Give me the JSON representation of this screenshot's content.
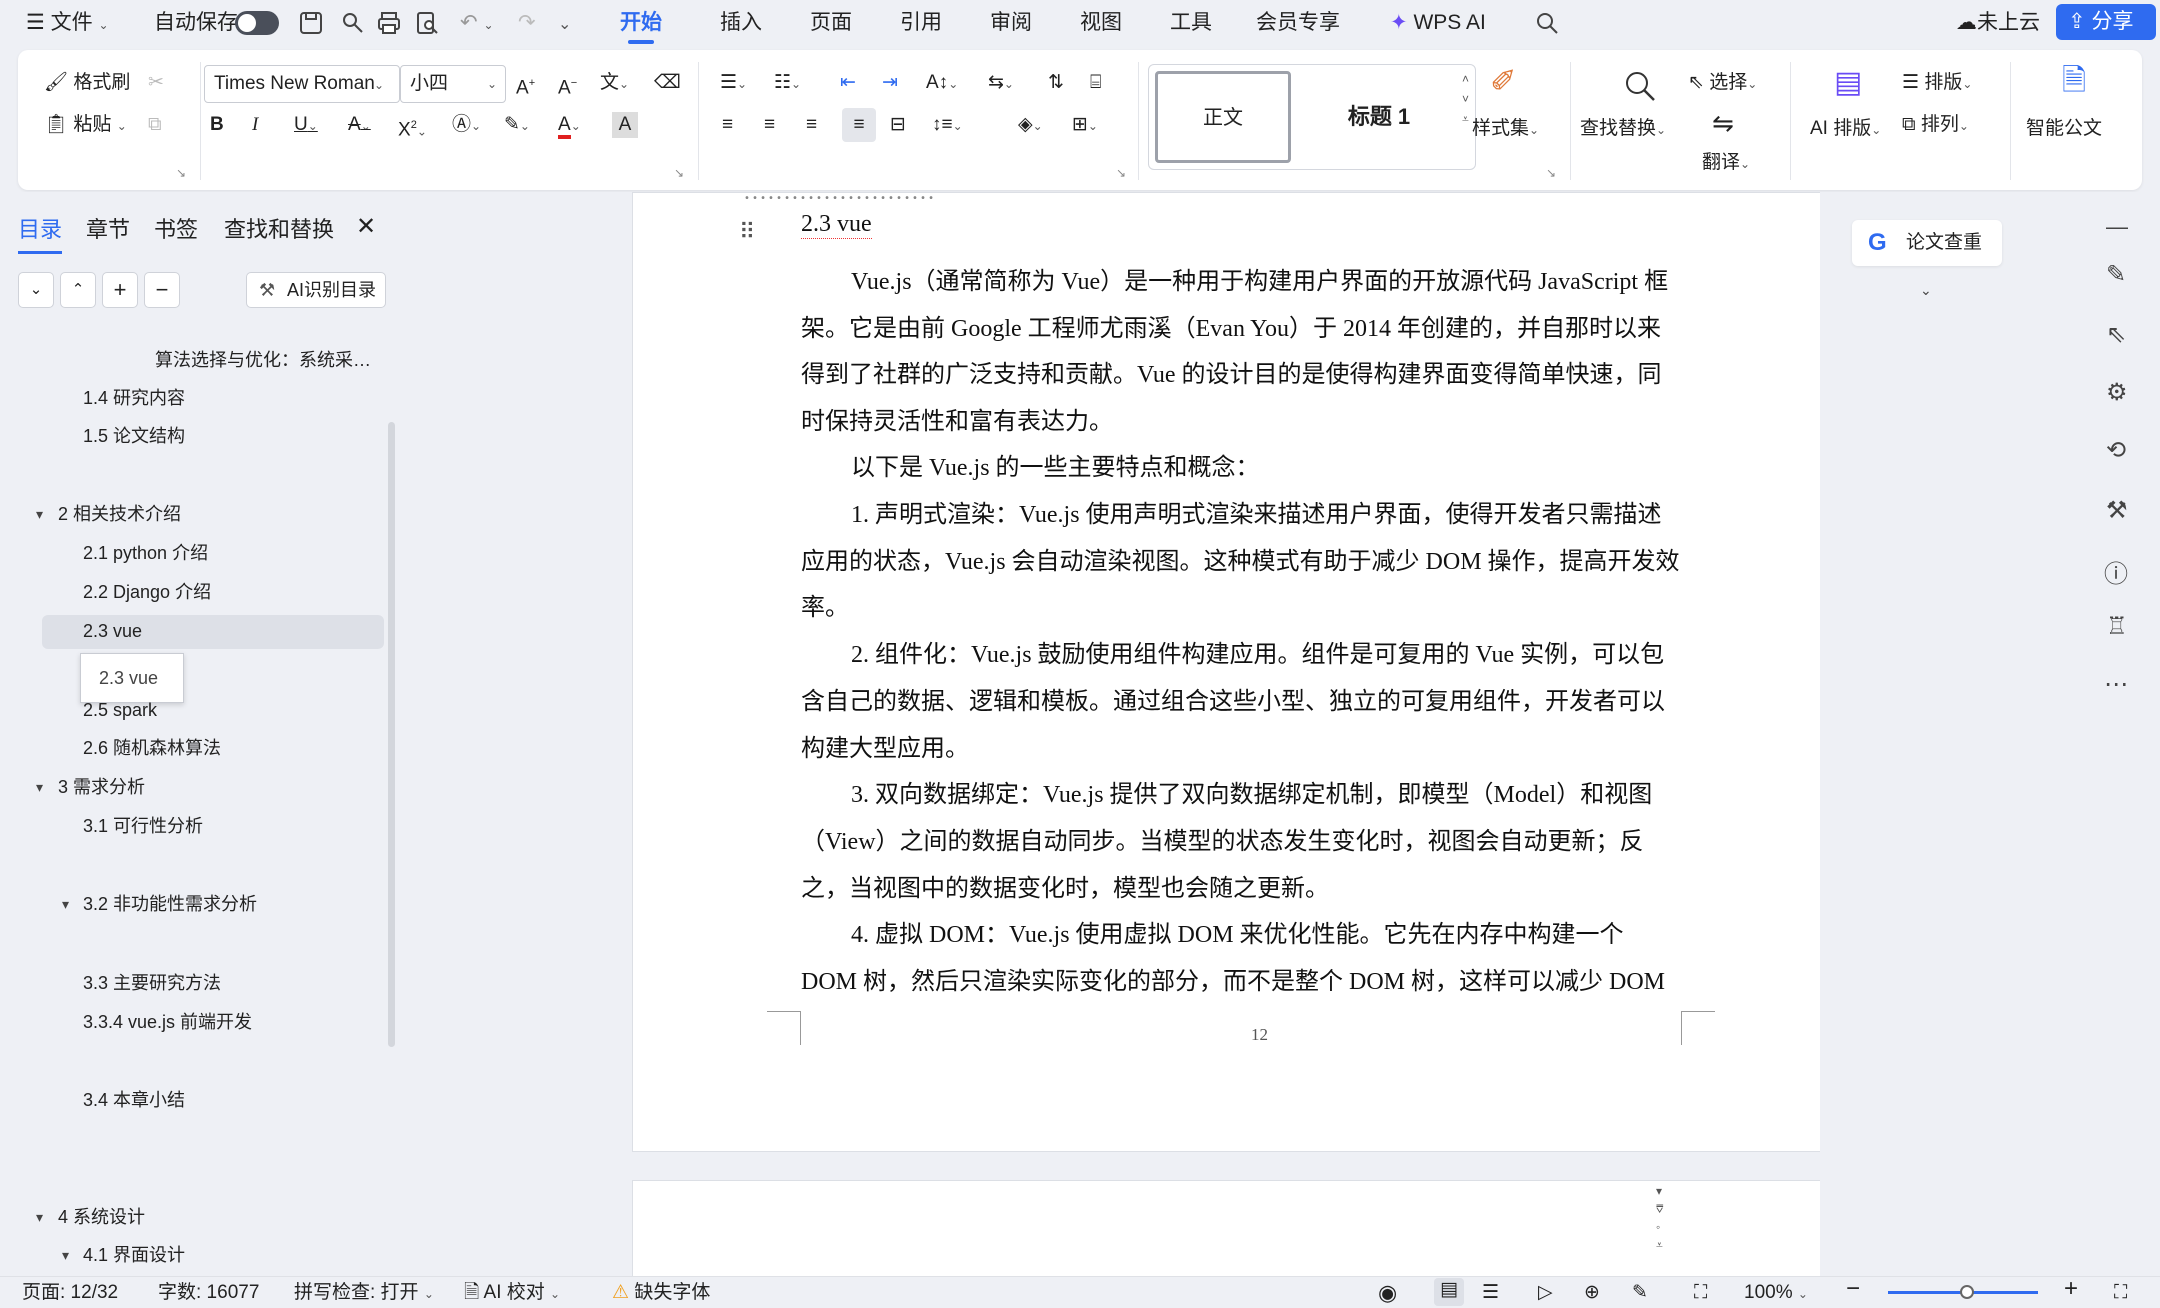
{
  "menu": {
    "file": "文件",
    "autosave": "自动保存",
    "tabs": [
      "开始",
      "插入",
      "页面",
      "引用",
      "审阅",
      "视图",
      "工具",
      "会员专享",
      "WPS AI"
    ],
    "cloud": "未上云",
    "share": "分享"
  },
  "ribbon": {
    "format_painter": "格式刷",
    "paste": "粘贴",
    "font_name": "Times New Roman",
    "font_size": "小四",
    "style_normal": "正文",
    "style_heading1": "标题 1",
    "style_set": "样式集",
    "find_replace": "查找替换",
    "select": "选择",
    "translate": "翻译",
    "ai_layout": "AI 排版",
    "layout": "排版",
    "arrange": "排列",
    "smart_doc": "智能公文"
  },
  "nav": {
    "tabs": [
      "目录",
      "章节",
      "书签",
      "查找和替换"
    ],
    "ai_toc": "AI识别目录",
    "tooltip": "2.3 vue",
    "items": [
      "算法选择与优化：系统采…",
      "1.4 研究内容",
      "1.5 论文结构",
      "2  相关技术介绍",
      "2.1 python 介绍",
      "2.2 Django  介绍",
      "2.3 vue",
      "2.5 spark",
      "2.6  随机森林算法",
      "3  需求分析",
      "3.1 可行性分析",
      "3.2  非功能性需求分析",
      "3.3 主要研究方法",
      "3.3.4 vue.js 前端开发",
      "3.4 本章小结",
      "4  系统设计",
      "4.1  界面设计"
    ]
  },
  "doc": {
    "heading": "2.3 vue",
    "page_number": "12",
    "lines": [
      "Vue.js（通常简称为  Vue）是一种用于构建用户界面的开放源代码 JavaScript 框",
      "架。它是由前 Google 工程师尤雨溪（Evan You）于 2014 年创建的，并自那时以来",
      "得到了社群的广泛支持和贡献。Vue 的设计目的是使得构建界面变得简单快速，同",
      "时保持灵活性和富有表达力。",
      "以下是 Vue.js 的一些主要特点和概念：",
      "1.  声明式渲染：Vue.js 使用声明式渲染来描述用户界面，使得开发者只需描述",
      "应用的状态，Vue.js 会自动渲染视图。这种模式有助于减少 DOM 操作，提高开发效",
      "率。",
      "2.  组件化：Vue.js 鼓励使用组件构建应用。组件是可复用的 Vue 实例，可以包",
      "含自己的数据、逻辑和模板。通过组合这些小型、独立的可复用组件，开发者可以",
      "构建大型应用。",
      "3.  双向数据绑定：Vue.js 提供了双向数据绑定机制，即模型（Model）和视图",
      "（View）之间的数据自动同步。当模型的状态发生变化时，视图会自动更新；反",
      "之，当视图中的数据变化时，模型也会随之更新。",
      "4.  虚拟 DOM：Vue.js 使用虚拟 DOM 来优化性能。它先在内存中构建一个",
      "DOM 树，然后只渲染实际变化的部分，而不是整个 DOM 树，这样可以减少 DOM"
    ]
  },
  "right": {
    "paper_check": "论文查重"
  },
  "status": {
    "page": "页面: 12/32",
    "words": "字数: 16077",
    "spell": "拼写检查: 打开",
    "ai_check": "AI 校对",
    "missing_font": "缺失字体",
    "zoom": "100%"
  },
  "colors": {
    "accent": "#2f6bf0",
    "font_color": "#e02020",
    "warning": "#f0a020"
  }
}
